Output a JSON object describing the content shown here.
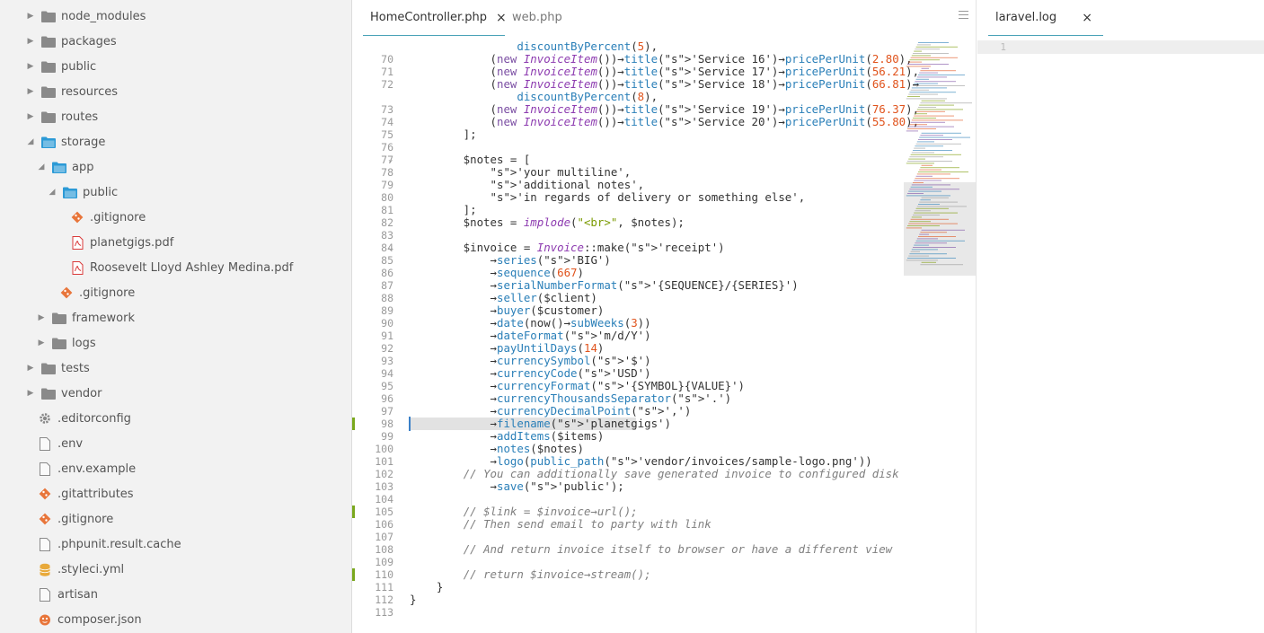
{
  "sidebar": {
    "items": [
      {
        "label": "node_modules",
        "type": "folder",
        "state": "collapsed"
      },
      {
        "label": "packages",
        "type": "folder",
        "state": "collapsed"
      },
      {
        "label": "public",
        "type": "folder",
        "state": "collapsed"
      },
      {
        "label": "resources",
        "type": "folder",
        "state": "collapsed"
      },
      {
        "label": "routes",
        "type": "folder",
        "state": "collapsed"
      },
      {
        "label": "storage",
        "type": "folder",
        "state": "expanded"
      },
      {
        "label": "app",
        "type": "folder",
        "state": "expanded"
      },
      {
        "label": "public",
        "type": "folder",
        "state": "expanded"
      },
      {
        "label": ".gitignore",
        "type": "git"
      },
      {
        "label": "planetgigs.pdf",
        "type": "pdf"
      },
      {
        "label": "Roosevelt Lloyd Ashley Medina.pdf",
        "type": "pdf"
      },
      {
        "label": ".gitignore",
        "type": "git"
      },
      {
        "label": "framework",
        "type": "folder",
        "state": "collapsed"
      },
      {
        "label": "logs",
        "type": "folder",
        "state": "collapsed"
      },
      {
        "label": "tests",
        "type": "folder",
        "state": "collapsed"
      },
      {
        "label": "vendor",
        "type": "folder",
        "state": "collapsed"
      },
      {
        "label": ".editorconfig",
        "type": "gear"
      },
      {
        "label": ".env",
        "type": "file"
      },
      {
        "label": ".env.example",
        "type": "file"
      },
      {
        "label": ".gitattributes",
        "type": "git"
      },
      {
        "label": ".gitignore",
        "type": "git"
      },
      {
        "label": ".phpunit.result.cache",
        "type": "file"
      },
      {
        "label": ".styleci.yml",
        "type": "db"
      },
      {
        "label": "artisan",
        "type": "file"
      },
      {
        "label": "composer.json",
        "type": "composer"
      }
    ]
  },
  "tabs": {
    "main": [
      {
        "label": "HomeController.php",
        "close": "×"
      },
      {
        "label": "web.php"
      }
    ],
    "log": {
      "label": "laravel.log",
      "close": "×"
    }
  },
  "log_line_number": "1",
  "code": {
    "lines": [
      {
        "n": "",
        "t": "                discountByPercent(5),"
      },
      {
        "n": "70",
        "t": "            (new InvoiceItem())→title('Service 16')→pricePerUnit(2.80),"
      },
      {
        "n": "71",
        "t": "            (new InvoiceItem())→title('Service 17')→pricePerUnit(56.21),"
      },
      {
        "n": "72",
        "t": "            (new InvoiceItem())→title('Service 18')→pricePerUnit(66.81)→"
      },
      {
        "n": "",
        "t": "                discountByPercent(8),"
      },
      {
        "n": "73",
        "t": "            (new InvoiceItem())→title('Service 19')→pricePerUnit(76.37),"
      },
      {
        "n": "74",
        "t": "            (new InvoiceItem())→title('Service 20')→pricePerUnit(55.80),"
      },
      {
        "n": "75",
        "t": "        ];"
      },
      {
        "n": "76",
        "t": ""
      },
      {
        "n": "77",
        "t": "        $notes = ["
      },
      {
        "n": "78",
        "t": "            'your multiline',"
      },
      {
        "n": "79",
        "t": "            'additional notes',"
      },
      {
        "n": "80",
        "t": "            'in regards of delivery or something else',"
      },
      {
        "n": "81",
        "t": "        ];"
      },
      {
        "n": "82",
        "t": "        $notes = implode(\"<br>\", $notes);"
      },
      {
        "n": "83",
        "t": ""
      },
      {
        "n": "84",
        "t": "        $invoice = Invoice::make('receipt')"
      },
      {
        "n": "85",
        "t": "            →series('BIG')"
      },
      {
        "n": "86",
        "t": "            →sequence(667)"
      },
      {
        "n": "87",
        "t": "            →serialNumberFormat('{SEQUENCE}/{SERIES}')"
      },
      {
        "n": "88",
        "t": "            →seller($client)"
      },
      {
        "n": "89",
        "t": "            →buyer($customer)"
      },
      {
        "n": "90",
        "t": "            →date(now()→subWeeks(3))"
      },
      {
        "n": "91",
        "t": "            →dateFormat('m/d/Y')"
      },
      {
        "n": "92",
        "t": "            →payUntilDays(14)"
      },
      {
        "n": "93",
        "t": "            →currencySymbol('$')"
      },
      {
        "n": "94",
        "t": "            →currencyCode('USD')"
      },
      {
        "n": "95",
        "t": "            →currencyFormat('{SYMBOL}{VALUE}')"
      },
      {
        "n": "96",
        "t": "            →currencyThousandsSeparator('.')"
      },
      {
        "n": "97",
        "t": "            →currencyDecimalPoint(',')"
      },
      {
        "n": "98",
        "t": "            →filename('planetgigs')"
      },
      {
        "n": "99",
        "t": "            →addItems($items)"
      },
      {
        "n": "100",
        "t": "            →notes($notes)"
      },
      {
        "n": "101",
        "t": "            →logo(public_path('vendor/invoices/sample-logo.png'))"
      },
      {
        "n": "102",
        "t": "        // You can additionally save generated invoice to configured disk"
      },
      {
        "n": "103",
        "t": "            →save('public');"
      },
      {
        "n": "104",
        "t": ""
      },
      {
        "n": "105",
        "t": "        // $link = $invoice→url();"
      },
      {
        "n": "106",
        "t": "        // Then send email to party with link"
      },
      {
        "n": "107",
        "t": ""
      },
      {
        "n": "108",
        "t": "        // And return invoice itself to browser or have a different view"
      },
      {
        "n": "109",
        "t": ""
      },
      {
        "n": "110",
        "t": "        // return $invoice→stream();"
      },
      {
        "n": "111",
        "t": "    }"
      },
      {
        "n": "112",
        "t": "}"
      },
      {
        "n": "113",
        "t": ""
      }
    ]
  },
  "colors": {
    "accent": "#4aa3b8",
    "folder": "#8a8a8a",
    "folder_open": "#2c9ad6",
    "git": "#e8753a",
    "pdf": "#d93a3a",
    "gutter_mark": "#7aa81e"
  }
}
